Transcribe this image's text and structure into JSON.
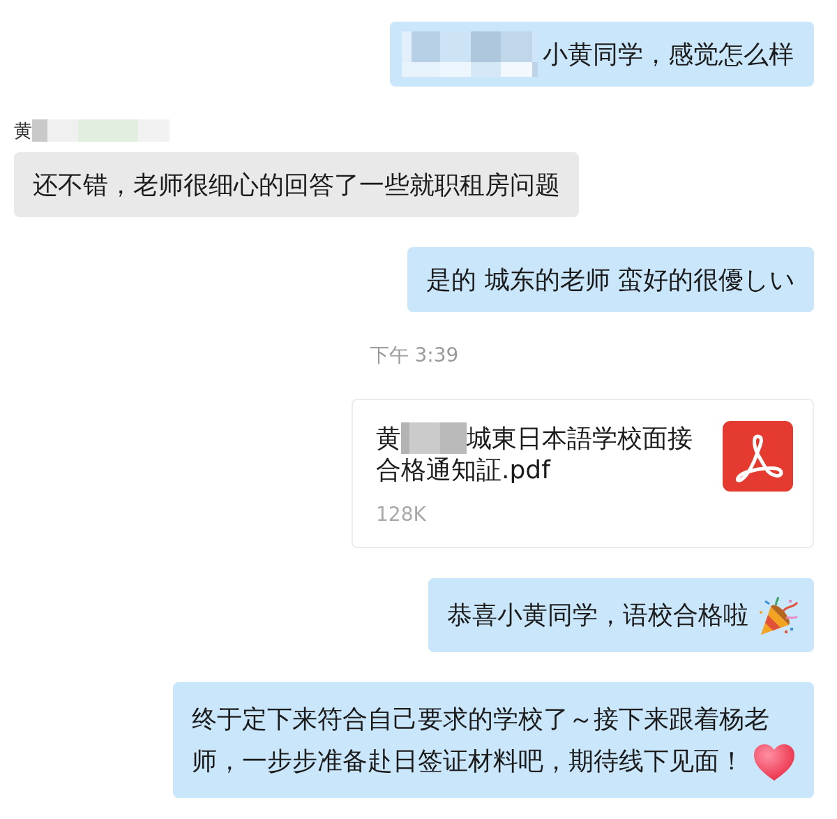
{
  "messages": [
    {
      "kind": "text",
      "outgoing": true,
      "redacted_lead": true,
      "text": "小黄同学，感觉怎么样"
    },
    {
      "kind": "text",
      "outgoing": false,
      "sender": {
        "name": "黄",
        "redacted": true
      },
      "text": "还不错，老师很细心的回答了一些就职租房问题"
    },
    {
      "kind": "text",
      "outgoing": true,
      "text": "是的 城东的老师 蛮好的很優しい"
    },
    {
      "kind": "time",
      "text": "下午 3:39"
    },
    {
      "kind": "file",
      "outgoing": true,
      "name_parts": [
        {
          "kind": "text",
          "text": "黄"
        },
        {
          "kind": "redacted"
        },
        {
          "kind": "text",
          "text": "城東日本語学校面接"
        },
        {
          "kind": "text",
          "text": "合格通知証.pdf"
        }
      ],
      "size": "128K"
    },
    {
      "kind": "text",
      "outgoing": true,
      "text": "恭喜小黄同学，语校合格啦",
      "emoji": {
        "kind": "party"
      }
    },
    {
      "kind": "text",
      "outgoing": true,
      "text": "终于定下来符合自己要求的学校了～接下来跟着杨老师，一步步准备赴日签证材料吧，期待线下见面！",
      "emoji": {
        "kind": "heart"
      }
    }
  ]
}
